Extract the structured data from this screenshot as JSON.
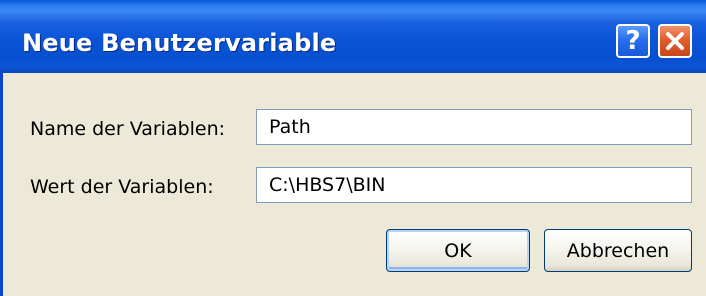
{
  "window": {
    "title": "Neue Benutzervariable",
    "help_button": "?",
    "close_button_icon": "close-icon",
    "title_color": "#0a53d6",
    "close_color": "#e25e2e"
  },
  "form": {
    "name_label": "Name der Variablen:",
    "name_value": "Path",
    "value_label": "Wert der Variablen:",
    "value_value": "C:\\HBS7\\BIN"
  },
  "buttons": {
    "ok_label": "OK",
    "cancel_label": "Abbrechen"
  }
}
